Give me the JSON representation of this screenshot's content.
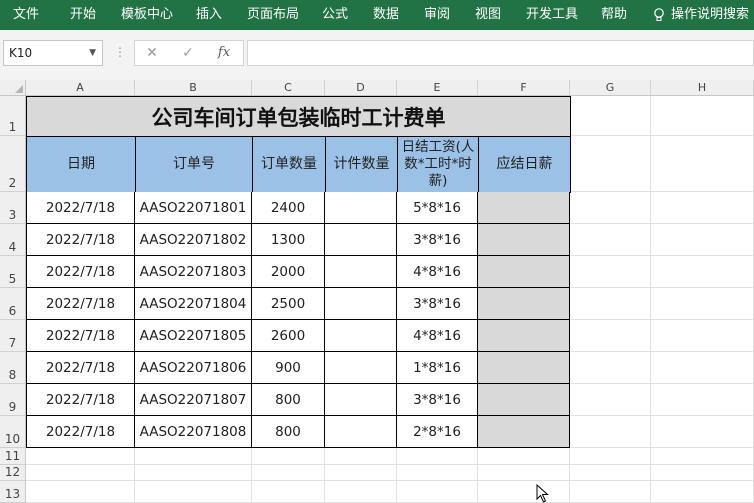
{
  "ribbon": {
    "tabs": [
      "文件",
      "开始",
      "模板中心",
      "插入",
      "页面布局",
      "公式",
      "数据",
      "审阅",
      "视图",
      "开发工具",
      "帮助"
    ],
    "tell_me": "操作说明搜索",
    "bulb_icon": "lightbulb-icon"
  },
  "formula_bar": {
    "name_box": "K10",
    "cancel": "✕",
    "enter": "✓",
    "fx": "fx",
    "value": ""
  },
  "columns": [
    "A",
    "B",
    "C",
    "D",
    "E",
    "F",
    "G",
    "H"
  ],
  "rows": [
    "1",
    "2",
    "3",
    "4",
    "5",
    "6",
    "7",
    "8",
    "9",
    "10",
    "11",
    "12",
    "13"
  ],
  "sheet": {
    "title": "公司车间订单包装临时工计费单",
    "headers": [
      "日期",
      "订单号",
      "订单数量",
      "计件数量",
      "日结工资(人数*工时*时薪)",
      "应结日薪"
    ],
    "data": [
      [
        "2022/7/18",
        "AASO22071801",
        "2400",
        "",
        "5*8*16",
        ""
      ],
      [
        "2022/7/18",
        "AASO22071802",
        "1300",
        "",
        "3*8*16",
        ""
      ],
      [
        "2022/7/18",
        "AASO22071803",
        "2000",
        "",
        "4*8*16",
        ""
      ],
      [
        "2022/7/18",
        "AASO22071804",
        "2500",
        "",
        "3*8*16",
        ""
      ],
      [
        "2022/7/18",
        "AASO22071805",
        "2600",
        "",
        "4*8*16",
        ""
      ],
      [
        "2022/7/18",
        "AASO22071806",
        "900",
        "",
        "1*8*16",
        ""
      ],
      [
        "2022/7/18",
        "AASO22071807",
        "800",
        "",
        "3*8*16",
        ""
      ],
      [
        "2022/7/18",
        "AASO22071808",
        "800",
        "",
        "2*8*16",
        ""
      ]
    ]
  },
  "colors": {
    "ribbon": "#217346",
    "header_fill": "#9bc2e6",
    "title_fill": "#d9d9d9",
    "total_fill": "#d9d9d9"
  }
}
